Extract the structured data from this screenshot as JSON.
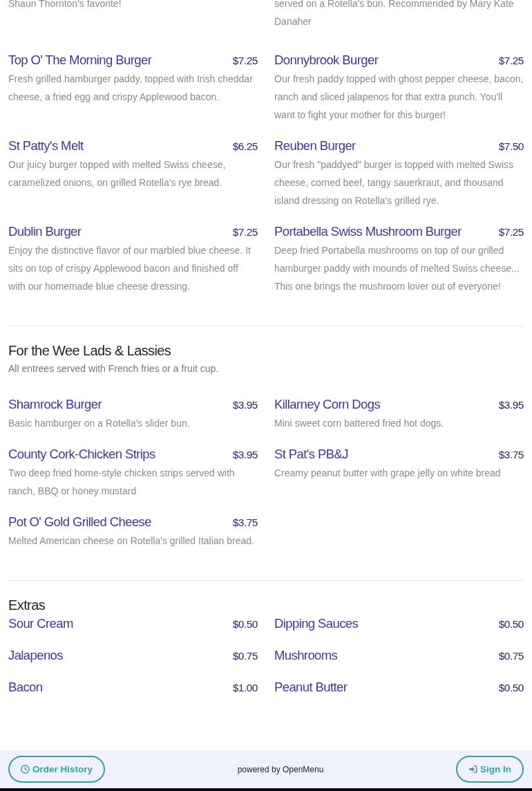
{
  "top_fragment": [
    "Shaun Thornton's favorite!",
    "served on a Rotella's bun. Recommended by Mary Kate Danaher"
  ],
  "items": [
    {
      "name": "Top O' The Morning Burger",
      "price": "$7.25",
      "description": "Fresh grilled hamburger paddy, topped with Irish cheddar cheese, a fried egg and crispy Applewood bacon."
    },
    {
      "name": "Donnybrook Burger",
      "price": "$7.25",
      "description": "Our fresh paddy topped with ghost pepper cheese, bacon, ranch and sliced jalapenos for that extra punch. You'll want to fight your mother for this burger!"
    },
    {
      "name": "St Patty's Melt",
      "price": "$6.25",
      "description": "Our juicy burger topped with melted Swiss cheese, caramelized onions, on grilled Rotella's rye bread."
    },
    {
      "name": "Reuben Burger",
      "price": "$7.50",
      "description": "Our fresh \"paddyed\" burger is topped with melted Swiss cheese, corned beef, tangy sauerkraut, and thousand island dressing on Rotella's grilled rye."
    },
    {
      "name": "Dublin Burger",
      "price": "$7.25",
      "description": "Enjoy the distinctive flavor of our marbled blue cheese. It sits on top of crispy Applewood bacon and finished off with our homemade blue cheese dressing."
    },
    {
      "name": "Portabella Swiss Mushroom Burger",
      "price": "$7.25",
      "description": "Deep fried Portabella mushrooms on top of our grilled hamburger paddy with mounds of melted Swiss cheese... This one brings the mushroom lover out of everyone!"
    }
  ],
  "sections": [
    {
      "title": "For the Wee Lads & Lassies",
      "subtitle": "All entrees served with French fries or a fruit cup.",
      "items": [
        {
          "name": "Shamrock Burger",
          "price": "$3.95",
          "description": "Basic hamburger on a Rotella's slider bun."
        },
        {
          "name": "Killarney Corn Dogs",
          "price": "$3.95",
          "description": "Mini sweet corn battered fried hot dogs."
        },
        {
          "name": "County Cork-Chicken Strips",
          "price": "$3.95",
          "description": "Two deep fried home-style chicken strips served with ranch, BBQ or honey mustard"
        },
        {
          "name": "St Pat's PB&J",
          "price": "$3.75",
          "description": "Creamy peanut butter with grape jelly on white bread"
        },
        {
          "name": "Pot O' Gold Grilled Cheese",
          "price": "$3.75",
          "description": "Melted American cheese on Rotella's grilled Italian bread."
        }
      ]
    },
    {
      "title": "Extras",
      "items": [
        {
          "name": "Sour Cream",
          "price": "$0.50"
        },
        {
          "name": "Dipping Sauces",
          "price": "$0.50"
        },
        {
          "name": "Jalapenos",
          "price": "$0.75"
        },
        {
          "name": "Mushrooms",
          "price": "$0.75"
        },
        {
          "name": "Bacon",
          "price": "$1.00"
        },
        {
          "name": "Peanut Butter",
          "price": "$0.50"
        }
      ]
    }
  ],
  "footer": {
    "left_button": "Order History",
    "credit": "powered by OpenMenu",
    "right_button": "Sign In"
  }
}
